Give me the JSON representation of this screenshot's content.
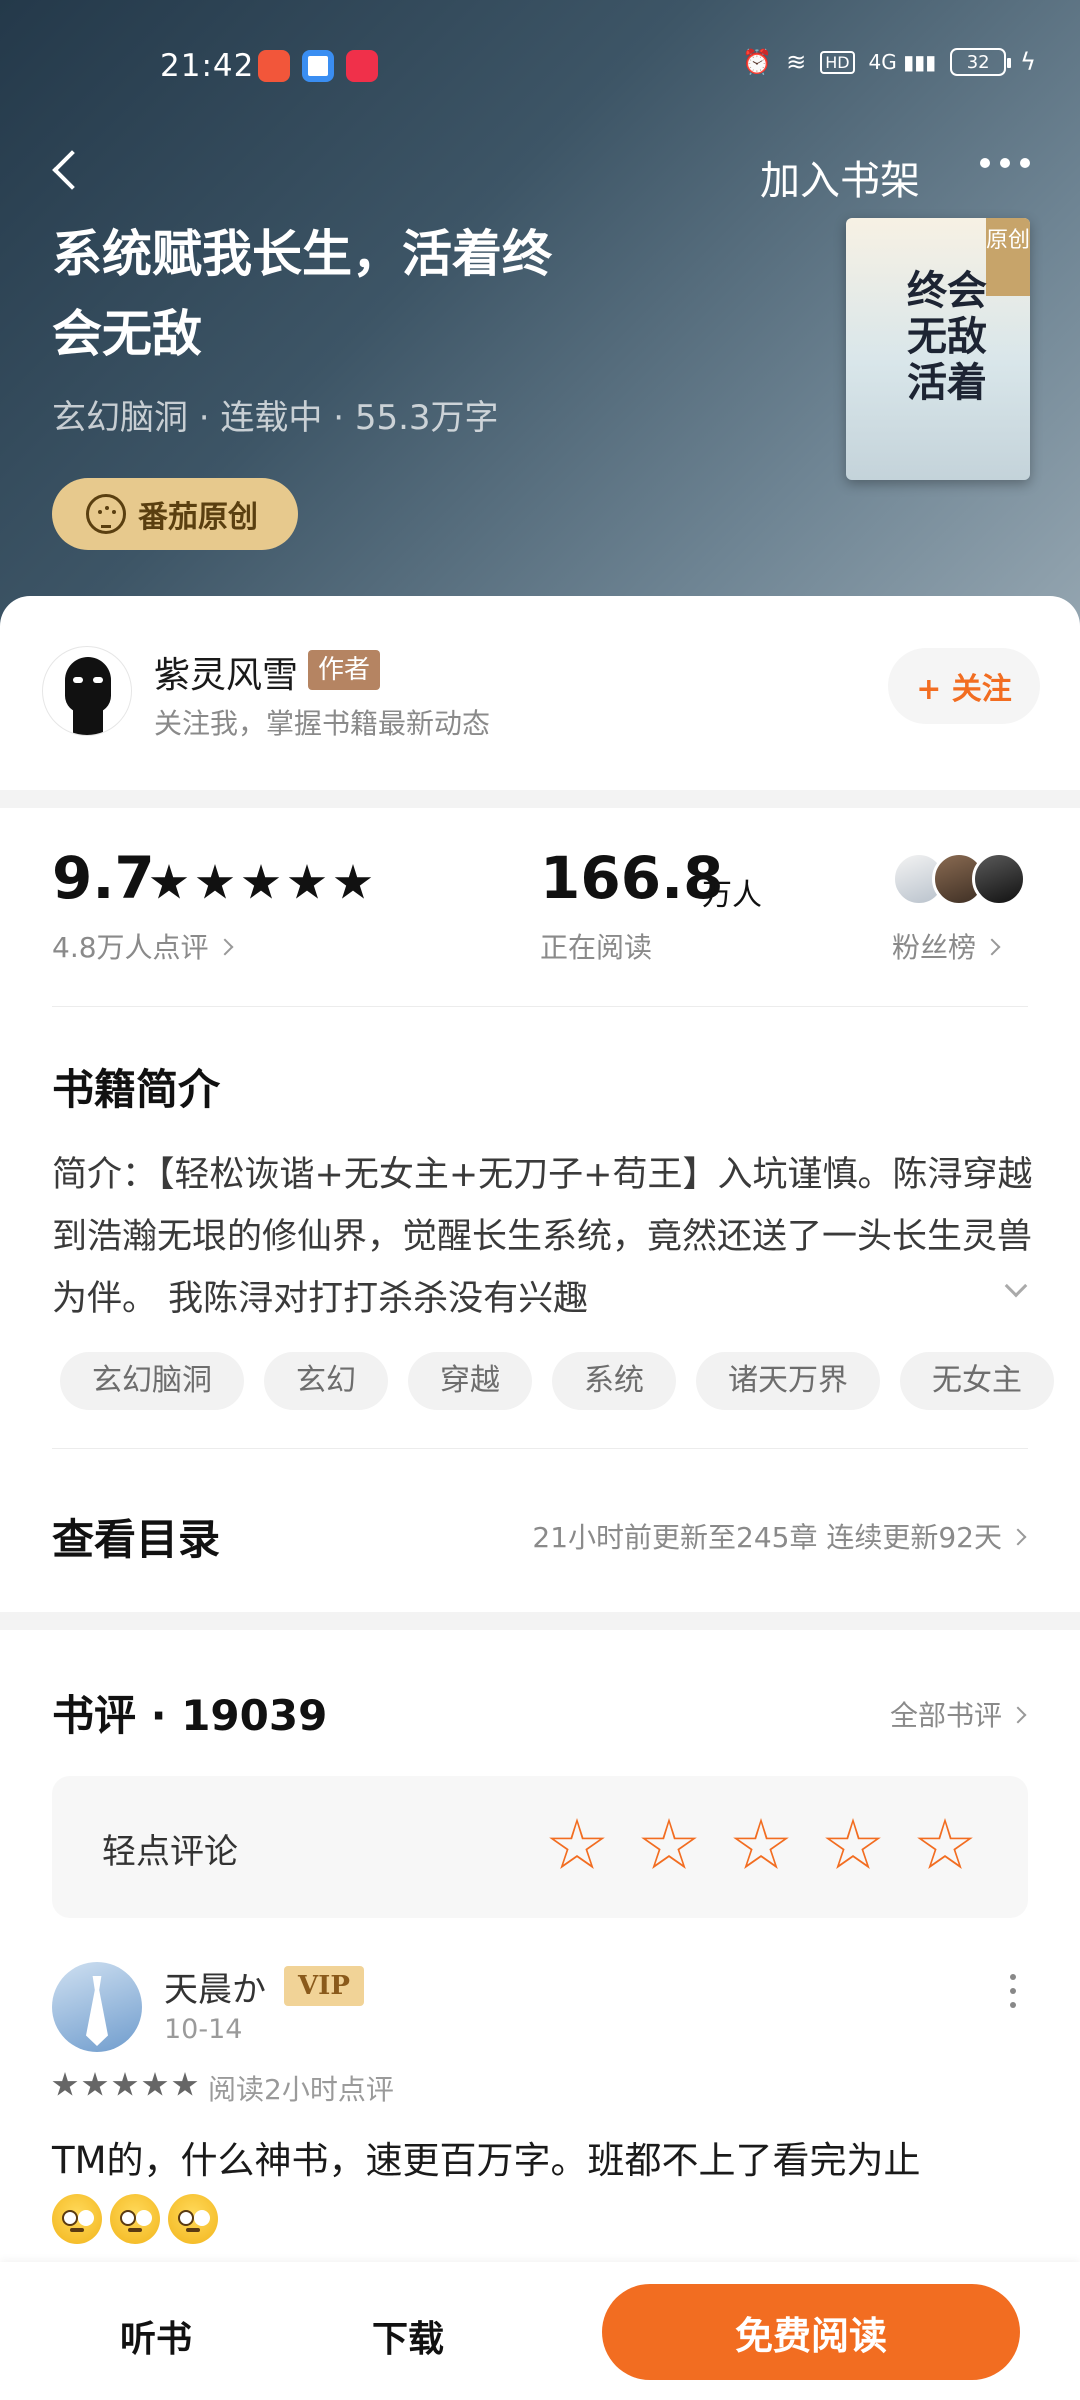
{
  "status_bar": {
    "time": "21:42",
    "network": "4G",
    "battery": "32",
    "icons": [
      "alarm-icon",
      "wifi-icon",
      "hd-icon",
      "signal-icon",
      "battery-icon",
      "charging-icon"
    ]
  },
  "nav": {
    "add_shelf": "加入书架"
  },
  "book": {
    "title": "系统赋我长生，活着终会无敌",
    "meta": "玄幻脑洞 · 连载中 · 55.3万字",
    "badge": "番茄原创",
    "cover_tag": "原创",
    "cover_title": "终会无敌活着"
  },
  "author": {
    "name": "紫灵风雪",
    "tag": "作者",
    "subtitle": "关注我，掌握书籍最新动态",
    "follow_label": "+ 关注"
  },
  "stats": {
    "score": "9.7",
    "star_rating": 5,
    "review_count": "4.8万人点评",
    "readers": "166.8",
    "readers_unit": "万人",
    "readers_label": "正在阅读",
    "fans_label": "粉丝榜"
  },
  "intro": {
    "title": "书籍简介",
    "text": "简介：【轻松诙谐+无女主+无刀子+苟王】入坑谨慎。陈浔穿越到浩瀚无垠的修仙界，觉醒长生系统，竟然还送了一头长生灵兽为伴。 我陈浔对打打杀杀没有兴趣"
  },
  "tags": [
    "玄幻脑洞",
    "玄幻",
    "穿越",
    "系统",
    "诸天万界",
    "无女主"
  ],
  "catalog": {
    "title": "查看目录",
    "info": "21小时前更新至245章 连续更新92天"
  },
  "reviews": {
    "title": "书评 · 19039",
    "all_label": "全部书评",
    "rate_prompt": "轻点评论",
    "items": [
      {
        "user": "天晨か",
        "badge": "VIP",
        "date": "10-14",
        "stars": 5,
        "meta": "阅读2小时点评",
        "text": "TM的，什么神书，速更百万字。班都不上了看完为止"
      }
    ]
  },
  "bottom_bar": {
    "listen": "听书",
    "download": "下载",
    "read": "免费阅读"
  },
  "colors": {
    "accent": "#f26d21",
    "badge_gold": "#e7c98d",
    "author_tag": "#b58462"
  }
}
